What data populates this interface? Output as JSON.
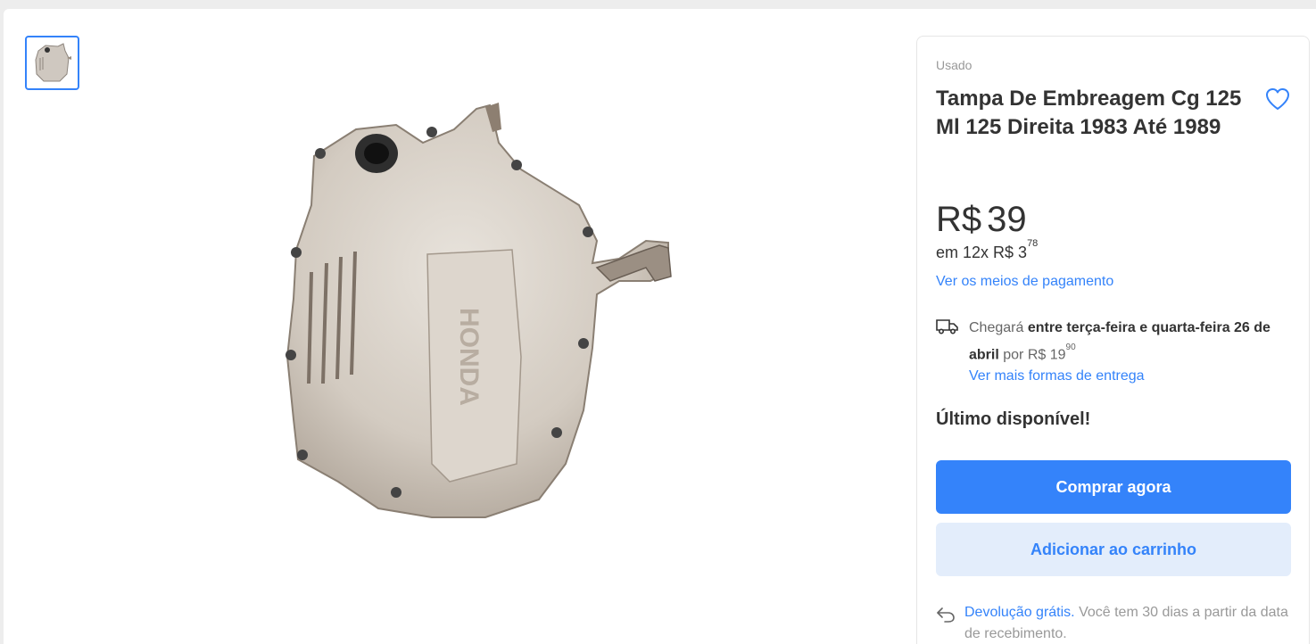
{
  "product": {
    "condition": "Usado",
    "title": "Tampa De Embreagem Cg 125 Ml 125 Direita 1983 Até 1989",
    "price_currency": "R$",
    "price_value": "39",
    "installments_prefix": "em 12x R$ 3",
    "installments_cents": "78",
    "payment_link": "Ver os meios de pagamento",
    "shipping_lead": "Chegará",
    "shipping_dates": "entre terça-feira e quarta-feira 26 de abril",
    "shipping_por": "por R$ 19",
    "shipping_cents": "90",
    "shipping_more_link": "Ver mais formas de entrega",
    "stock": "Último disponível!",
    "buy_label": "Comprar agora",
    "cart_label": "Adicionar ao carrinho",
    "returns_link": "Devolução grátis.",
    "returns_text": "Você tem 30 dias a partir da data de recebimento."
  },
  "icons": {
    "favorite": "heart-icon",
    "shipping": "truck-icon",
    "returns": "return-arrow-icon"
  },
  "colors": {
    "accent": "#3483fa",
    "accent_light": "#e3edfb",
    "background": "#ededed"
  }
}
